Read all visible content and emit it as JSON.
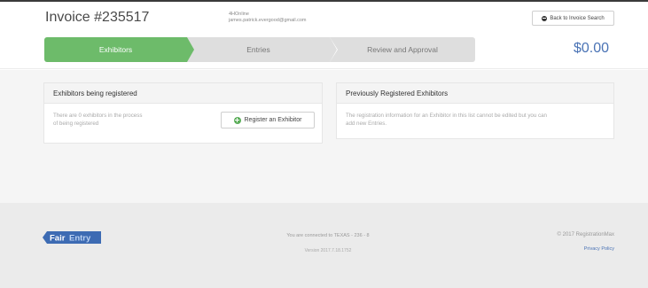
{
  "header": {
    "invoice_title": "Invoice #235517",
    "account_name": "4HOnline",
    "account_email": "james.patrick.evergood@gmail.com",
    "back_button": "Back to Invoice Search"
  },
  "steps": [
    {
      "label": "Exhibitors",
      "state": "active"
    },
    {
      "label": "Entries",
      "state": "inactive"
    },
    {
      "label": "Review and Approval",
      "state": "inactive"
    }
  ],
  "total": "$0.00",
  "exhibitors_panel": {
    "title": "Exhibitors being registered",
    "text_line1": "There are 0 exhibitors in the process",
    "text_line2": "of being registered",
    "register_button": "Register an Exhibitor"
  },
  "previous_panel": {
    "title": "Previously Registered Exhibitors",
    "text_line1": "The registration information for an Exhibitor in this list cannot be edited but you can",
    "text_line2": "add new Entries."
  },
  "footer": {
    "logo_part1": "Fair",
    "logo_part2": "Entry",
    "connected": "You are connected to TEXAS - 236 - 8",
    "version": "Version 2017.7.18.1752",
    "copyright": "© 2017 RegistrationMax",
    "privacy": "Privacy Policy"
  },
  "colors": {
    "accent_green": "#6dbb6a",
    "accent_blue": "#4a73b5",
    "logo_blue": "#3d6bb3"
  }
}
